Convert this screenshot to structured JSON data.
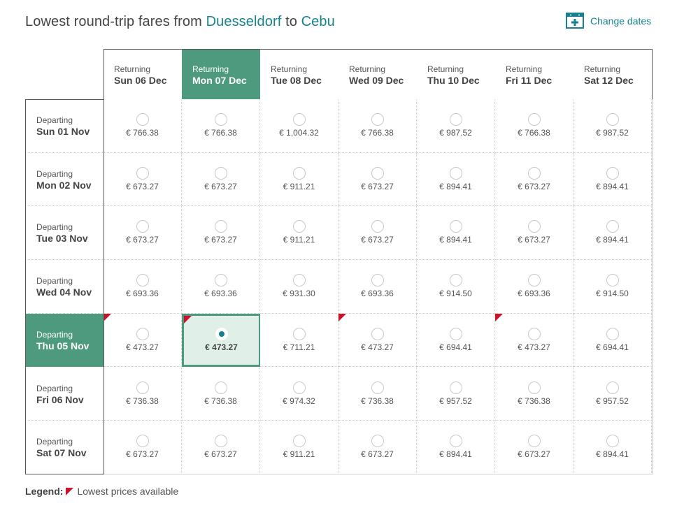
{
  "header": {
    "title_prefix": "Lowest round-trip fares from",
    "origin": "Duesseldorf",
    "title_mid": "to",
    "destination": "Cebu",
    "change_dates_label": "Change dates",
    "change_dates_icon": "calendar-plus-icon"
  },
  "colors": {
    "accent": "#17828f",
    "selected_header": "#4e9a7e",
    "selected_cell_bg": "#e0efe7",
    "lowest_flag": "#d0102a"
  },
  "columns": [
    {
      "small": "Returning",
      "date": "Sun 06 Dec",
      "selected": false
    },
    {
      "small": "Returning",
      "date": "Mon 07 Dec",
      "selected": true
    },
    {
      "small": "Returning",
      "date": "Tue 08 Dec",
      "selected": false
    },
    {
      "small": "Returning",
      "date": "Wed 09 Dec",
      "selected": false
    },
    {
      "small": "Returning",
      "date": "Thu 10 Dec",
      "selected": false
    },
    {
      "small": "Returning",
      "date": "Fri 11 Dec",
      "selected": false
    },
    {
      "small": "Returning",
      "date": "Sat 12 Dec",
      "selected": false
    }
  ],
  "rows": [
    {
      "small": "Departing",
      "date": "Sun 01 Nov",
      "selected": false,
      "prices": [
        "€ 766.38",
        "€ 766.38",
        "€ 1,004.32",
        "€ 766.38",
        "€ 987.52",
        "€ 766.38",
        "€ 987.52"
      ],
      "lowest": [
        false,
        false,
        false,
        false,
        false,
        false,
        false
      ]
    },
    {
      "small": "Departing",
      "date": "Mon 02 Nov",
      "selected": false,
      "prices": [
        "€ 673.27",
        "€ 673.27",
        "€ 911.21",
        "€ 673.27",
        "€ 894.41",
        "€ 673.27",
        "€ 894.41"
      ],
      "lowest": [
        false,
        false,
        false,
        false,
        false,
        false,
        false
      ]
    },
    {
      "small": "Departing",
      "date": "Tue 03 Nov",
      "selected": false,
      "prices": [
        "€ 673.27",
        "€ 673.27",
        "€ 911.21",
        "€ 673.27",
        "€ 894.41",
        "€ 673.27",
        "€ 894.41"
      ],
      "lowest": [
        false,
        false,
        false,
        false,
        false,
        false,
        false
      ]
    },
    {
      "small": "Departing",
      "date": "Wed 04 Nov",
      "selected": false,
      "prices": [
        "€ 693.36",
        "€ 693.36",
        "€ 931.30",
        "€ 693.36",
        "€ 914.50",
        "€ 693.36",
        "€ 914.50"
      ],
      "lowest": [
        false,
        false,
        false,
        false,
        false,
        false,
        false
      ]
    },
    {
      "small": "Departing",
      "date": "Thu 05 Nov",
      "selected": true,
      "prices": [
        "€ 473.27",
        "€ 473.27",
        "€ 711.21",
        "€ 473.27",
        "€ 694.41",
        "€ 473.27",
        "€ 694.41"
      ],
      "lowest": [
        true,
        true,
        false,
        true,
        false,
        true,
        false
      ]
    },
    {
      "small": "Departing",
      "date": "Fri 06 Nov",
      "selected": false,
      "prices": [
        "€ 736.38",
        "€ 736.38",
        "€ 974.32",
        "€ 736.38",
        "€ 957.52",
        "€ 736.38",
        "€ 957.52"
      ],
      "lowest": [
        false,
        false,
        false,
        false,
        false,
        false,
        false
      ]
    },
    {
      "small": "Departing",
      "date": "Sat 07 Nov",
      "selected": false,
      "prices": [
        "€ 673.27",
        "€ 673.27",
        "€ 911.21",
        "€ 673.27",
        "€ 894.41",
        "€ 673.27",
        "€ 894.41"
      ],
      "lowest": [
        false,
        false,
        false,
        false,
        false,
        false,
        false
      ]
    }
  ],
  "selected_cell": {
    "row": 4,
    "col": 1
  },
  "legend": {
    "label": "Legend:",
    "flag_icon": "red-corner-flag-icon",
    "text": "Lowest prices available"
  }
}
